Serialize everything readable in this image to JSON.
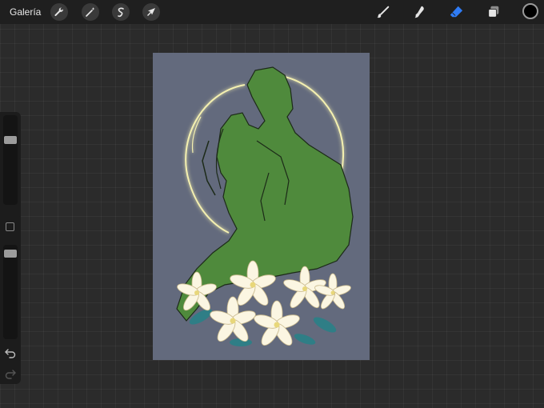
{
  "topbar": {
    "gallery_label": "Galería",
    "left_tools": [
      {
        "icon": "wrench-icon"
      },
      {
        "icon": "magic-wand-icon"
      },
      {
        "icon": "selection-icon"
      },
      {
        "icon": "transform-arrow-icon"
      }
    ],
    "right_tools": [
      {
        "icon": "brush-icon"
      },
      {
        "icon": "smudge-icon"
      },
      {
        "icon": "eraser-icon",
        "active": true
      },
      {
        "icon": "layers-icon"
      }
    ],
    "current_color": "#000000"
  },
  "sidebar": {
    "brush_size_icon": "brush-size-slider",
    "opacity_icon": "opacity-slider",
    "modify_icon": "modify-square-icon",
    "undo_icon": "undo-icon",
    "redo_icon": "redo-icon"
  },
  "colors": {
    "canvas_bg": "#636a7d",
    "figure_green": "#4f8a3c",
    "halo": "#f4f0b0",
    "accent_blue": "#2f7cf6"
  }
}
